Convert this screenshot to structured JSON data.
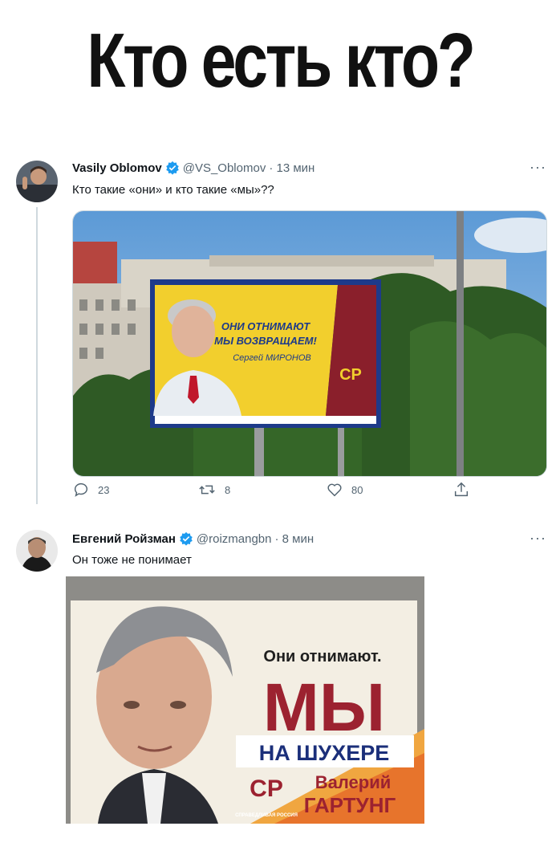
{
  "headline": "Кто есть кто?",
  "tweet1": {
    "name": "Vasily Oblomov",
    "handle": "@VS_Oblomov",
    "time": "· 13 мин",
    "text": "Кто такие «они» и кто такие «мы»??",
    "billboard": {
      "line1": "ОНИ ОТНИМАЮТ",
      "line2": "МЫ ВОЗВРАЩАЕМ!",
      "line3": "Сергей МИРОНОВ",
      "logo": "СР"
    },
    "replies": "23",
    "retweets": "8",
    "likes": "80"
  },
  "tweet2": {
    "name": "Евгений Ройзман",
    "handle": "@roizmangbn",
    "time": "· 8 мин",
    "text": "Он тоже не понимает",
    "poster": {
      "line1": "Они отнимают.",
      "line2": "МЫ",
      "sticker": "НА ШУХЕРЕ",
      "name1": "Валерий",
      "name2": "ГАРТУНГ",
      "logo": "СР",
      "party": "СПРАВЕДЛИВАЯ РОССИЯ"
    }
  },
  "more_label": "···",
  "colors": {
    "verified": "#1d9bf0",
    "yellow": "#f2cf2d",
    "maroon": "#8a1f2b"
  }
}
